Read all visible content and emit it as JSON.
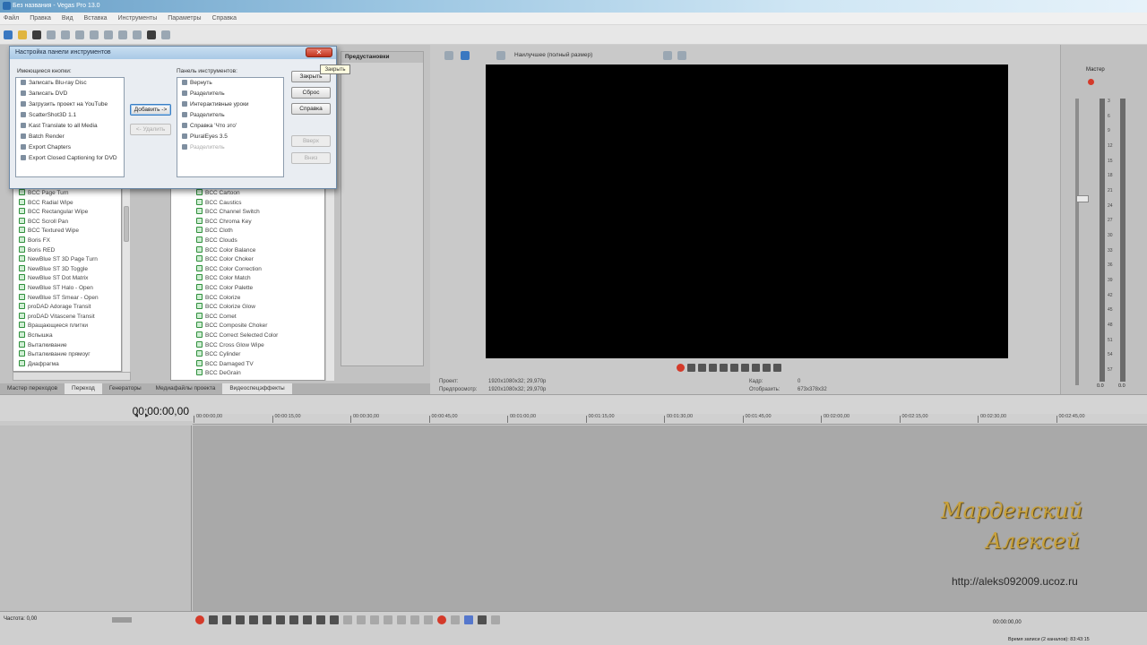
{
  "window": {
    "title": "Без названия - Vegas Pro 13.0"
  },
  "menu": [
    "Файл",
    "Правка",
    "Вид",
    "Вставка",
    "Инструменты",
    "Параметры",
    "Справка"
  ],
  "left_panel": {
    "effects_left": [
      "BCC Page Turn",
      "BCC Radial Wipe",
      "BCC Rectangular Wipe",
      "BCC Scroll Pan",
      "BCC Textured Wipe",
      "Boris FX",
      "Boris RED",
      "NewBlue ST 3D Page Turn",
      "NewBlue ST 3D Toggle",
      "NewBlue ST Dot Matrix",
      "NewBlue ST Halo - Open",
      "NewBlue ST Smear - Open",
      "proDAD Adorage Transit",
      "proDAD Vitascene Transit",
      "Вращающиеся плитки",
      "Вспышка",
      "Выталкивание",
      "Выталкивание прямоуг",
      "Диафрагма"
    ],
    "effects_right": [
      "BCC Cartoon",
      "BCC Caustics",
      "BCC Channel Switch",
      "BCC Chroma Key",
      "BCC Cloth",
      "BCC Clouds",
      "BCC Color Balance",
      "BCC Color Choker",
      "BCC Color Correction",
      "BCC Color Match",
      "BCC Color Palette",
      "BCC Colorize",
      "BCC Colorize Glow",
      "BCC Comet",
      "BCC Composite Choker",
      "BCC Correct Selected Color",
      "BCC Cross Glow Wipe",
      "BCC Cylinder",
      "BCC Damaged TV",
      "BCC DeGrain"
    ],
    "tabs": [
      "Мастер переходов",
      "Переход",
      "Генераторы",
      "Медиафайлы проекта",
      "Видеоспецэффекты"
    ],
    "presets_header": "Предустановки"
  },
  "dialog": {
    "title": "Настройка панели инструментов",
    "available_label": "Имеющиеся кнопки:",
    "toolbar_label": "Панель инструментов:",
    "available": [
      "Записать Blu-ray Disc",
      "Записать DVD",
      "Загрузить проект на YouTube",
      "ScatterShot3D 1.1",
      "Kast Translate to all Media",
      "Batch Render",
      "Export Chapters",
      "Export Closed Captioning for DVD"
    ],
    "toolbar": [
      "Вернуть",
      "Разделитель",
      "Интерактивные уроки",
      "Разделитель",
      "Справка 'Что это'",
      "PluralEyes 3.5",
      "Разделитель"
    ],
    "add_button": "Добавить ->",
    "remove_button": "<- Удалить",
    "close_button": "Закрыть",
    "reset_button": "Сброс",
    "help_button": "Справка",
    "up_button": "Вверх",
    "down_button": "Вниз",
    "close_tooltip": "Закрыть"
  },
  "preview": {
    "quality": "Наилучшее (полный размер)",
    "project_label": "Проект:",
    "project_value": "1920x1080x32; 29,970p",
    "preview_label": "Предпросмотр:",
    "preview_value": "1920x1080x32; 29,970p",
    "frame_label": "Кадр:",
    "frame_value": "0",
    "display_label": "Отобразить:",
    "display_value": "673x378x32"
  },
  "master": {
    "label": "Мастер",
    "scale": [
      "3",
      "6",
      "9",
      "12",
      "15",
      "18",
      "21",
      "24",
      "27",
      "30",
      "33",
      "36",
      "39",
      "42",
      "45",
      "48",
      "51",
      "54",
      "57"
    ],
    "bottom_left": "0.0",
    "bottom_right": "0.0"
  },
  "timeline": {
    "timecode": "00:00:00,00",
    "ruler": [
      "00:00:00,00",
      "00:00:15,00",
      "00:00:30,00",
      "00:00:45,00",
      "00:01:00,00",
      "00:01:15,00",
      "00:01:30,00",
      "00:01:45,00",
      "00:02:00,00",
      "00:02:15,00",
      "00:02:30,00",
      "00:02:45,00"
    ]
  },
  "status": {
    "rate": "Частота: 0,00",
    "position": "00:00:00,00",
    "record_time": "Время записи (2 каналов): 83:43:15"
  },
  "watermark": {
    "name_line1": "Марденский",
    "name_line2": "Алексей",
    "url": "http://aleks092009.ucoz.ru"
  }
}
